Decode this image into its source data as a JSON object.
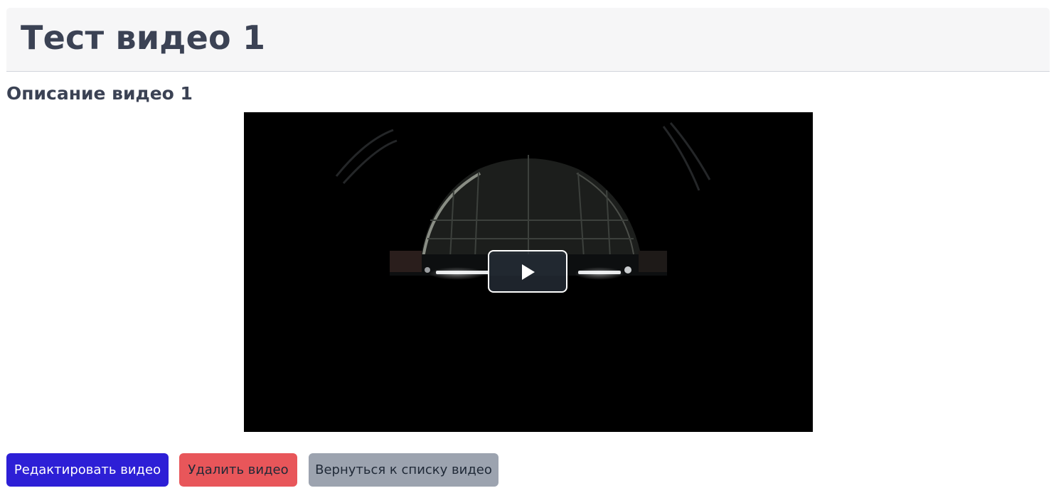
{
  "header": {
    "title": "Тест видео 1"
  },
  "video": {
    "description": "Описание видео 1",
    "play_icon": "play-icon"
  },
  "actions": {
    "edit_label": "Редактировать видео",
    "delete_label": "Удалить видео",
    "back_label": "Вернуться к списку видео"
  },
  "colors": {
    "edit": "#2d1fd6",
    "delete": "#e8565a",
    "back": "#9ca3af",
    "header_bg": "#f6f6f7",
    "title": "#3b4254"
  }
}
